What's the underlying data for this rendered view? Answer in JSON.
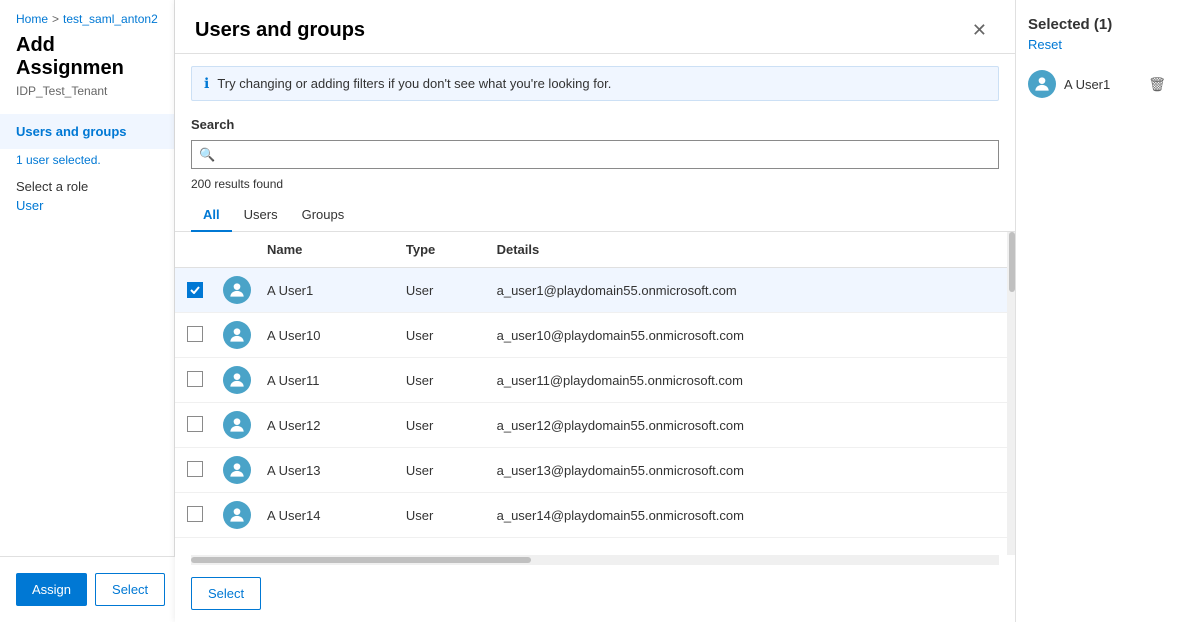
{
  "breadcrumb": {
    "home": "Home",
    "separator": ">",
    "item": "test_saml_anton2"
  },
  "leftPanel": {
    "pageTitle": "Add Assignmen",
    "tenantName": "IDP_Test_Tenant",
    "navItems": [
      {
        "label": "Users and groups",
        "active": true
      },
      {
        "subLabel": "1 user selected."
      },
      {
        "secondaryLabel": "Select a role"
      },
      {
        "roleValue": "User"
      }
    ],
    "buttons": {
      "assign": "Assign",
      "select": "Select"
    }
  },
  "modal": {
    "title": "Users and groups",
    "closeLabel": "✕",
    "infoText": "Try changing or adding filters if you don't see what you're looking for.",
    "searchLabel": "Search",
    "searchPlaceholder": "",
    "resultsCount": "200 results found",
    "tabs": [
      {
        "label": "All",
        "active": true
      },
      {
        "label": "Users",
        "active": false
      },
      {
        "label": "Groups",
        "active": false
      }
    ],
    "table": {
      "columns": [
        "",
        "",
        "Name",
        "Type",
        "Details"
      ],
      "rows": [
        {
          "checked": true,
          "name": "A User1",
          "type": "User",
          "details": "a_user1@playdomain55.onmicrosoft.com",
          "selected": true
        },
        {
          "checked": false,
          "name": "A User10",
          "type": "User",
          "details": "a_user10@playdomain55.onmicrosoft.com",
          "selected": false
        },
        {
          "checked": false,
          "name": "A User11",
          "type": "User",
          "details": "a_user11@playdomain55.onmicrosoft.com",
          "selected": false
        },
        {
          "checked": false,
          "name": "A User12",
          "type": "User",
          "details": "a_user12@playdomain55.onmicrosoft.com",
          "selected": false
        },
        {
          "checked": false,
          "name": "A User13",
          "type": "User",
          "details": "a_user13@playdomain55.onmicrosoft.com",
          "selected": false
        },
        {
          "checked": false,
          "name": "A User14",
          "type": "User",
          "details": "a_user14@playdomain55.onmicrosoft.com",
          "selected": false
        }
      ]
    },
    "footer": {
      "selectBtn": "Select"
    }
  },
  "selectedPanel": {
    "title": "Selected (1)",
    "resetLabel": "Reset",
    "users": [
      {
        "name": "A User1"
      }
    ]
  }
}
